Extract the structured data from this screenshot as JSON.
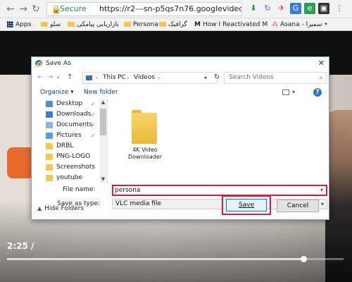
{
  "browser": {
    "security_label": "Secure",
    "url": "https://r2---sn-p5qs7n76.googlevideo.com...",
    "bookmarks": [
      {
        "label": "Apps",
        "kind": "grid"
      },
      {
        "label": "سلو",
        "kind": "folder"
      },
      {
        "label": "بازاریابی پیامکی",
        "kind": "folder"
      },
      {
        "label": "Persona",
        "kind": "folder"
      },
      {
        "label": "گرافیک",
        "kind": "folder"
      },
      {
        "label": "How I Reactivated M",
        "kind": "page"
      },
      {
        "label": "Asana - سمیرا •",
        "kind": "page"
      }
    ]
  },
  "video": {
    "timecode": "2:25 /",
    "progress_fraction": 0.88
  },
  "dialog": {
    "title": "Save As",
    "path": {
      "segment1": "This PC",
      "segment2": "Videos"
    },
    "search_placeholder": "Search Videos",
    "toolbar": {
      "organize": "Organize ▾",
      "new_folder": "New folder"
    },
    "sidebar_items": [
      {
        "label": "Desktop",
        "pinned": true,
        "color": "#4a8fd8"
      },
      {
        "label": "Downloads",
        "pinned": true,
        "color": "#3a7bd5"
      },
      {
        "label": "Documents",
        "pinned": true,
        "color": "#8ab4e8"
      },
      {
        "label": "Pictures",
        "pinned": true,
        "color": "#5aa0e0"
      },
      {
        "label": "DRBL",
        "pinned": false,
        "color": "#f4c84d"
      },
      {
        "label": "PNG-LOGO",
        "pinned": false,
        "color": "#f4c84d"
      },
      {
        "label": "Screenshots",
        "pinned": false,
        "color": "#f4c84d"
      },
      {
        "label": "youtube",
        "pinned": false,
        "color": "#f4c84d"
      }
    ],
    "files": [
      {
        "name": "4K Video Downloader"
      }
    ],
    "file_name_label": "File name:",
    "file_name_value": "persona",
    "save_type_label": "Save as type:",
    "save_type_value": "VLC media file",
    "hide_folders": "Hide Folders",
    "save_button": "Save",
    "cancel_button": "Cancel",
    "highlight_color": "#d31f3b"
  }
}
